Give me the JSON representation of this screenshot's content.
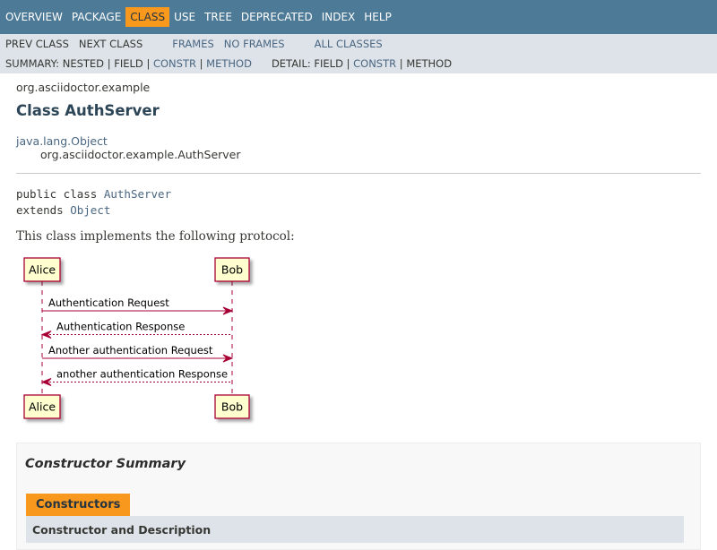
{
  "topnav": {
    "items": [
      "OVERVIEW",
      "PACKAGE",
      "CLASS",
      "USE",
      "TREE",
      "DEPRECATED",
      "INDEX",
      "HELP"
    ],
    "active_index": 2
  },
  "subnav": {
    "prev_class": "PREV CLASS",
    "next_class": "NEXT CLASS",
    "frames": "FRAMES",
    "no_frames": "NO FRAMES",
    "all_classes": "ALL CLASSES",
    "summary_label": "SUMMARY:",
    "summary_nested": "NESTED",
    "summary_field": "FIELD",
    "summary_constr": "CONSTR",
    "summary_method": "METHOD",
    "detail_label": "DETAIL:",
    "detail_field": "FIELD",
    "detail_constr": "CONSTR",
    "detail_method": "METHOD",
    "sep": "|"
  },
  "header": {
    "package": "org.asciidoctor.example",
    "title": "Class AuthServer"
  },
  "inheritance": {
    "parent": "java.lang.Object",
    "child": "org.asciidoctor.example.AuthServer"
  },
  "declaration": {
    "kw_public_class": "public class ",
    "class_name": "AuthServer",
    "kw_extends": "extends ",
    "super_name": "Object"
  },
  "description": "This class implements the following protocol:",
  "diagram": {
    "participants": [
      "Alice",
      "Bob"
    ],
    "messages": [
      {
        "label": "Authentication Request",
        "dir": "right",
        "style": "solid"
      },
      {
        "label": "Authentication Response",
        "dir": "left",
        "style": "dashed"
      },
      {
        "label": "Another authentication Request",
        "dir": "right",
        "style": "solid"
      },
      {
        "label": "another authentication Response",
        "dir": "left",
        "style": "dashed"
      }
    ],
    "colors": {
      "box_fill": "#fefece",
      "box_stroke": "#a80036",
      "arrow": "#a80036"
    }
  },
  "constructor_summary": {
    "title": "Constructor Summary",
    "tab": "Constructors",
    "column_header": "Constructor and Description"
  },
  "colors": {
    "nav_bg": "#4d7a97",
    "subnav_bg": "#dee3e9",
    "accent": "#f8981d",
    "link": "#4a6782"
  }
}
